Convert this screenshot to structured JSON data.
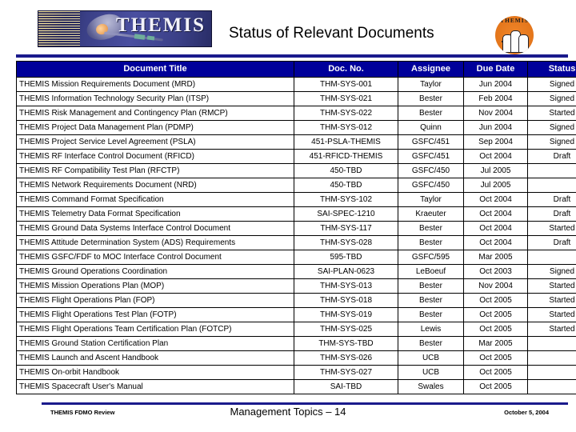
{
  "header": {
    "title": "Status of Relevant Documents",
    "banner_wordmark": "THEMIS",
    "round_logo_text": "THEMIS"
  },
  "table": {
    "columns": [
      "Document Title",
      "Doc. No.",
      "Assignee",
      "Due Date",
      "Status"
    ],
    "rows": [
      {
        "title": "THEMIS Mission Requirements Document (MRD)",
        "doc_no": "THM-SYS-001",
        "assignee": "Taylor",
        "due_date": "Jun 2004",
        "status": "Signed"
      },
      {
        "title": "THEMIS Information Technology Security Plan (ITSP)",
        "doc_no": "THM-SYS-021",
        "assignee": "Bester",
        "due_date": "Feb 2004",
        "status": "Signed"
      },
      {
        "title": "THEMIS Risk Management and Contingency Plan (RMCP)",
        "doc_no": "THM-SYS-022",
        "assignee": "Bester",
        "due_date": "Nov 2004",
        "status": "Started"
      },
      {
        "title": "THEMIS Project Data Management Plan (PDMP)",
        "doc_no": "THM-SYS-012",
        "assignee": "Quinn",
        "due_date": "Jun 2004",
        "status": "Signed"
      },
      {
        "title": "THEMIS Project Service Level Agreement (PSLA)",
        "doc_no": "451-PSLA-THEMIS",
        "assignee": "GSFC/451",
        "due_date": "Sep 2004",
        "status": "Signed"
      },
      {
        "title": "THEMIS RF Interface Control Document (RFICD)",
        "doc_no": "451-RFICD-THEMIS",
        "assignee": "GSFC/451",
        "due_date": "Oct 2004",
        "status": "Draft"
      },
      {
        "title": "THEMIS RF Compatibility Test Plan (RFCTP)",
        "doc_no": "450-TBD",
        "assignee": "GSFC/450",
        "due_date": "Jul 2005",
        "status": ""
      },
      {
        "title": "THEMIS Network Requirements Document (NRD)",
        "doc_no": "450-TBD",
        "assignee": "GSFC/450",
        "due_date": "Jul 2005",
        "status": ""
      },
      {
        "title": "THEMIS Command Format Specification",
        "doc_no": "THM-SYS-102",
        "assignee": "Taylor",
        "due_date": "Oct 2004",
        "status": "Draft"
      },
      {
        "title": "THEMIS Telemetry Data Format Specification",
        "doc_no": "SAI-SPEC-1210",
        "assignee": "Kraeuter",
        "due_date": "Oct 2004",
        "status": "Draft"
      },
      {
        "title": "THEMIS Ground Data Systems Interface Control Document",
        "doc_no": "THM-SYS-117",
        "assignee": "Bester",
        "due_date": "Oct 2004",
        "status": "Started"
      },
      {
        "title": "THEMIS Attitude Determination System (ADS) Requirements",
        "doc_no": "THM-SYS-028",
        "assignee": "Bester",
        "due_date": "Oct 2004",
        "status": "Draft"
      },
      {
        "title": "THEMIS GSFC/FDF to MOC Interface Control Document",
        "doc_no": "595-TBD",
        "assignee": "GSFC/595",
        "due_date": "Mar 2005",
        "status": ""
      },
      {
        "title": "THEMIS Ground Operations Coordination",
        "doc_no": "SAI-PLAN-0623",
        "assignee": "LeBoeuf",
        "due_date": "Oct 2003",
        "status": "Signed"
      },
      {
        "title": "THEMIS Mission Operations Plan (MOP)",
        "doc_no": "THM-SYS-013",
        "assignee": "Bester",
        "due_date": "Nov 2004",
        "status": "Started"
      },
      {
        "title": "THEMIS Flight Operations Plan (FOP)",
        "doc_no": "THM-SYS-018",
        "assignee": "Bester",
        "due_date": "Oct 2005",
        "status": "Started"
      },
      {
        "title": "THEMIS Flight Operations Test Plan (FOTP)",
        "doc_no": "THM-SYS-019",
        "assignee": "Bester",
        "due_date": "Oct 2005",
        "status": "Started"
      },
      {
        "title": "THEMIS Flight Operations Team Certification Plan (FOTCP)",
        "doc_no": "THM-SYS-025",
        "assignee": "Lewis",
        "due_date": "Oct 2005",
        "status": "Started"
      },
      {
        "title": "THEMIS Ground Station Certification Plan",
        "doc_no": "THM-SYS-TBD",
        "assignee": "Bester",
        "due_date": "Mar 2005",
        "status": ""
      },
      {
        "title": "THEMIS Launch and Ascent Handbook",
        "doc_no": "THM-SYS-026",
        "assignee": "UCB",
        "due_date": "Oct 2005",
        "status": ""
      },
      {
        "title": "THEMIS On-orbit Handbook",
        "doc_no": "THM-SYS-027",
        "assignee": "UCB",
        "due_date": "Oct 2005",
        "status": ""
      },
      {
        "title": "THEMIS Spacecraft User's Manual",
        "doc_no": "SAI-TBD",
        "assignee": "Swales",
        "due_date": "Oct 2005",
        "status": ""
      }
    ]
  },
  "footer": {
    "left": "THEMIS FDMO Review",
    "center": "Management Topics – 14",
    "right": "October 5, 2004"
  },
  "colors": {
    "header_blue": "#00009a",
    "rule_blue": "#1a1a8c",
    "logo_orange": "#e4761b"
  }
}
